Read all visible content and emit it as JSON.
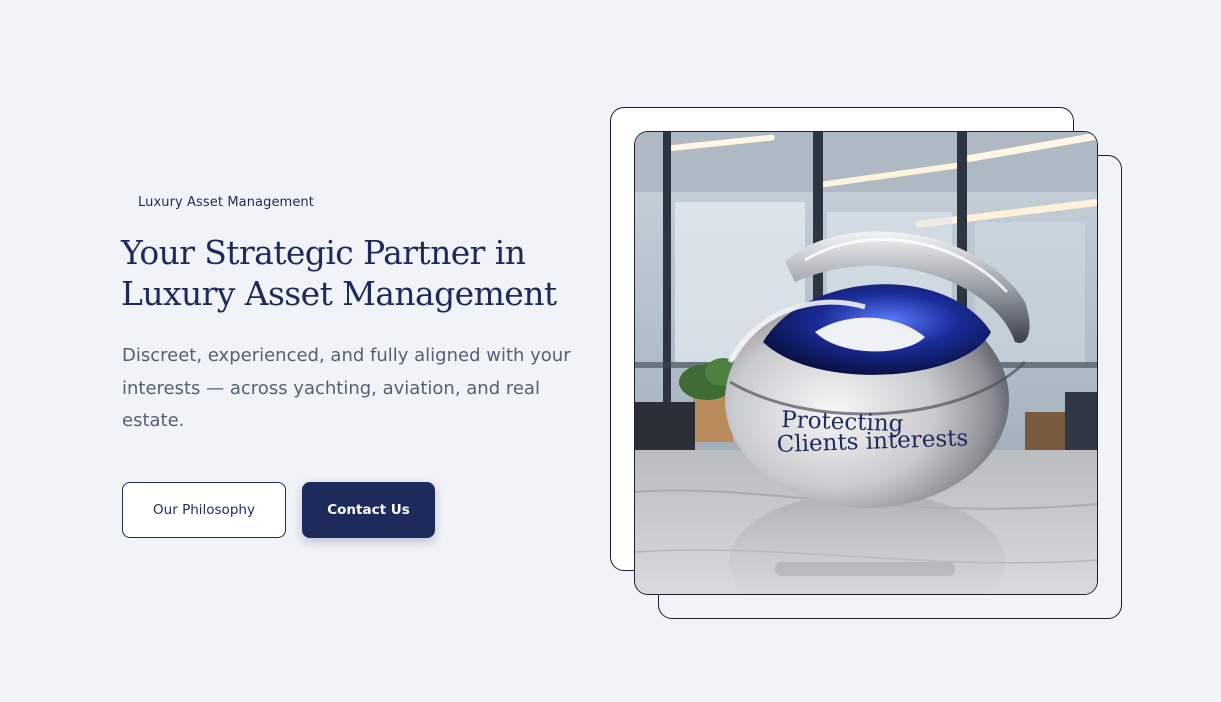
{
  "hero": {
    "eyebrow": "Luxury Asset Management",
    "headline_line1": "Your Strategic Partner in",
    "headline_line2": "Luxury Asset Management",
    "subtext": "Discreet, experienced, and fully aligned with your interests — across yachting, aviation, and real estate.",
    "buttons": {
      "philosophy": "Our Philosophy",
      "contact": "Contact Us"
    }
  },
  "image": {
    "engraving_line1": "Protecting",
    "engraving_line2": "Clients interests"
  },
  "colors": {
    "background": "#f0f3f8",
    "brand_navy": "#1f2a5c",
    "body_text": "#566073"
  }
}
